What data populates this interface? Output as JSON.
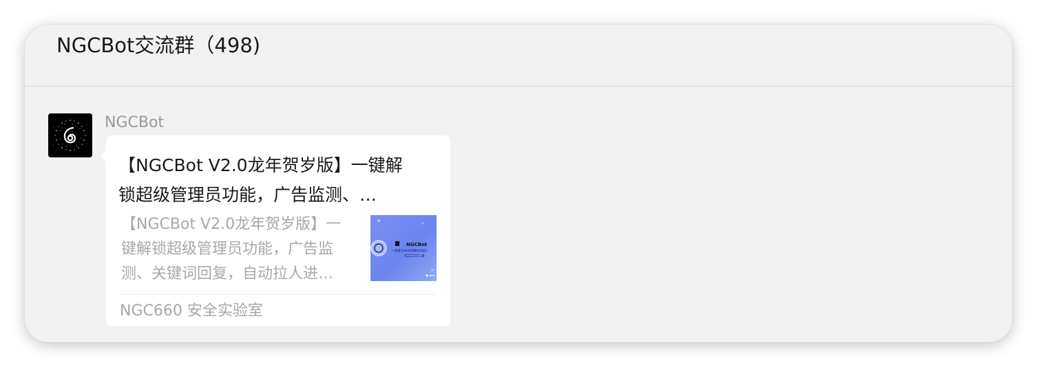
{
  "chat": {
    "title": "NGCBot交流群（498)"
  },
  "message": {
    "sender": "NGCBot",
    "avatar_icon": "swirl-logo-icon",
    "card": {
      "title": "【NGCBot V2.0龙年贺岁版】一键解\n锁超级管理员功能，广告监测、…",
      "description": "【NGCBot V2.0龙年贺岁版】一\n键解锁超级管理员功能，广告监\n测、关键词回复，自动拉人进…",
      "thumbnail": {
        "brand": "NGCBot",
        "subtitle": "一款基于Hook的微信机器人",
        "tag": "NGC660安全实验室"
      },
      "source": "NGC660 安全实验室"
    }
  },
  "colors": {
    "window_bg": "#f2f2f2",
    "bubble_bg": "#ffffff",
    "title_text": "#191919",
    "muted_text": "#a8a8a8",
    "thumb_blue": "#6f86f2"
  }
}
